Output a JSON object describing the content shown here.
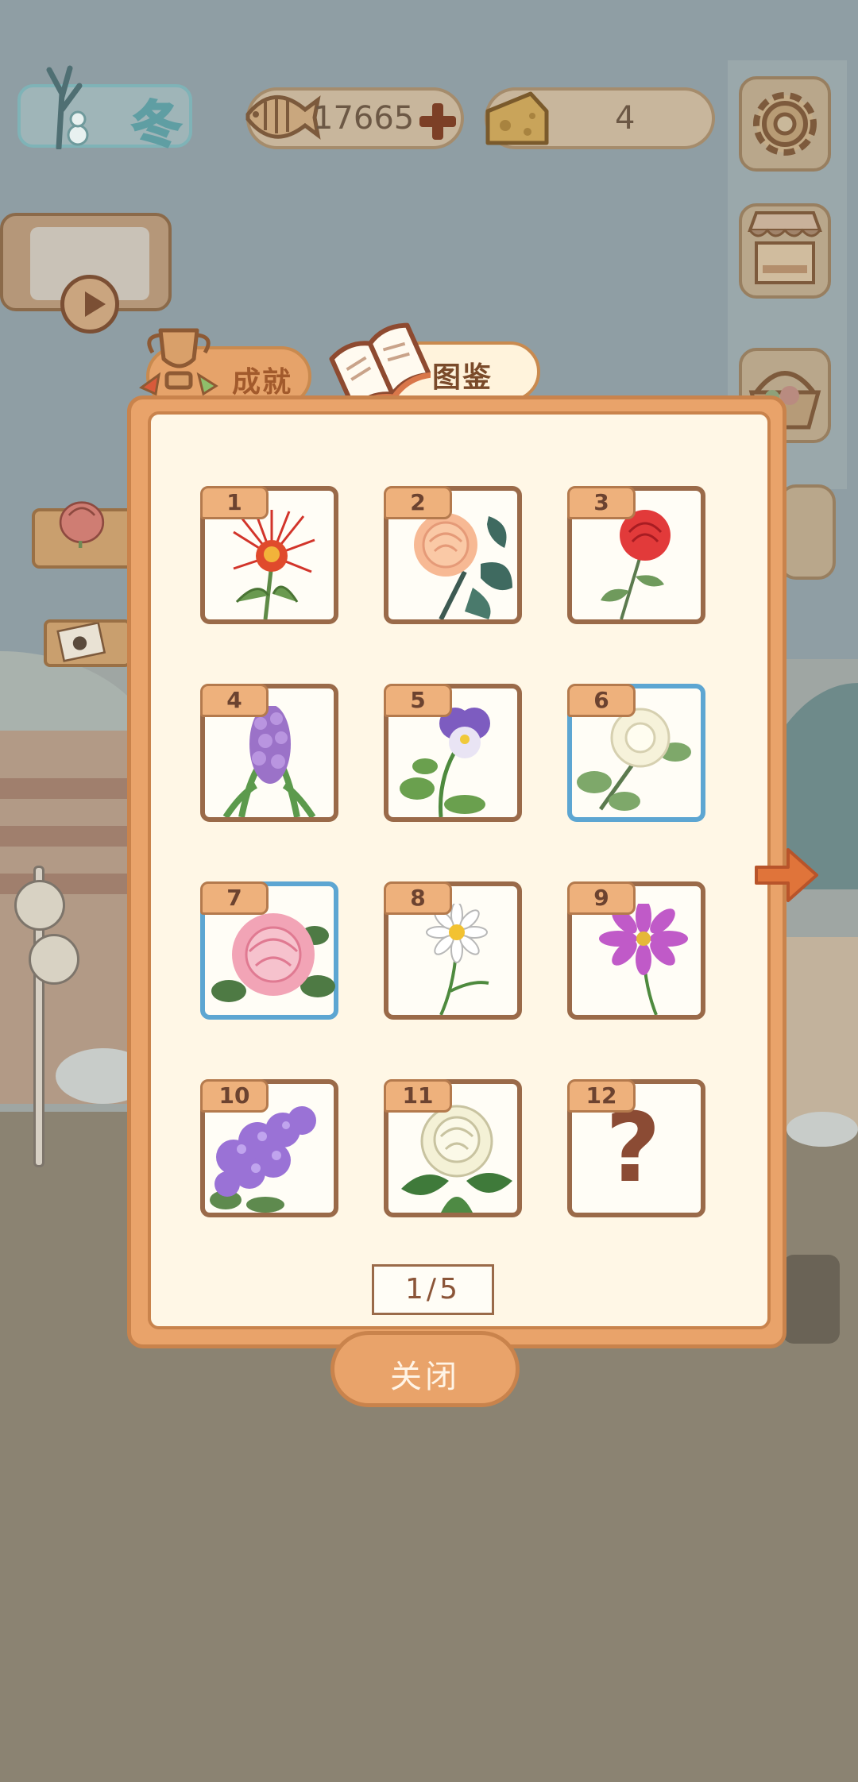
{
  "hud": {
    "season_label": "冬",
    "fish_coins": "17665",
    "cheese_count": "4"
  },
  "tabs": [
    {
      "label": "成就",
      "active": false
    },
    {
      "label": "图鉴",
      "active": true
    }
  ],
  "collection": {
    "cards": [
      {
        "number": "1",
        "flower": "red-spider-lily",
        "selected": false,
        "unlocked": true
      },
      {
        "number": "2",
        "flower": "peach-rose",
        "selected": false,
        "unlocked": true
      },
      {
        "number": "3",
        "flower": "red-rose",
        "selected": false,
        "unlocked": true
      },
      {
        "number": "4",
        "flower": "hyacinth",
        "selected": false,
        "unlocked": true
      },
      {
        "number": "5",
        "flower": "pansy",
        "selected": false,
        "unlocked": true
      },
      {
        "number": "6",
        "flower": "white-gardenia",
        "selected": true,
        "unlocked": true
      },
      {
        "number": "7",
        "flower": "pink-peony",
        "selected": true,
        "unlocked": true
      },
      {
        "number": "8",
        "flower": "daisy",
        "selected": false,
        "unlocked": true
      },
      {
        "number": "9",
        "flower": "cosmos",
        "selected": false,
        "unlocked": true
      },
      {
        "number": "10",
        "flower": "lilac",
        "selected": false,
        "unlocked": true
      },
      {
        "number": "11",
        "flower": "white-camellia",
        "selected": false,
        "unlocked": true
      },
      {
        "number": "12",
        "flower": "unknown",
        "selected": false,
        "unlocked": false,
        "placeholder": "?"
      }
    ],
    "pager": "1/5"
  },
  "close_label": "关闭",
  "icons": {
    "fish": "fish-bone-icon",
    "plus": "plus-icon",
    "cheese": "cheese-icon",
    "gear": "gear-icon",
    "shop": "shop-stall-icon",
    "basket": "flower-basket-icon",
    "trophy": "trophy-icon",
    "book": "open-book-icon",
    "next": "arrow-right-icon",
    "play": "play-icon"
  },
  "colors": {
    "panel_orange": "#e9a36a",
    "panel_cream": "#fff7e6",
    "card_border": "#9a6a49",
    "card_selected": "#5da6d2",
    "text_brown": "#7a4a2a"
  }
}
